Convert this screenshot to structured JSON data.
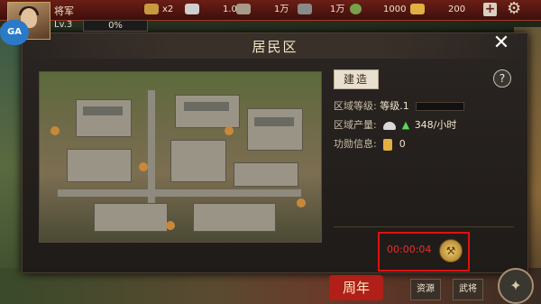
{
  "player": {
    "name": "将军",
    "level": "Lv.3",
    "xp": "0%"
  },
  "resources": [
    {
      "icon": "horn-icon",
      "value": "x2"
    },
    {
      "icon": "silver-icon",
      "value": "1.0万"
    },
    {
      "icon": "wood-icon",
      "value": "1万"
    },
    {
      "icon": "iron-icon",
      "value": "1万"
    },
    {
      "icon": "food-icon",
      "value": "1000"
    },
    {
      "icon": "gold-icon",
      "value": "200"
    }
  ],
  "modal": {
    "title": "居民区",
    "build_label": "建造",
    "help_label": "?",
    "close_label": "✕",
    "area_level_label": "区域等级:",
    "area_level_value": "等级.1",
    "output_label": "区域产量:",
    "output_value": "348/小时",
    "merit_label": "功勋信息:",
    "merit_value": "0",
    "timer": "00:00:04"
  },
  "bottom": {
    "banner": "周年",
    "tabs": [
      "资源",
      "武将"
    ]
  },
  "colors": {
    "accent_red": "#e21010",
    "topbar": "#6a1e16"
  }
}
